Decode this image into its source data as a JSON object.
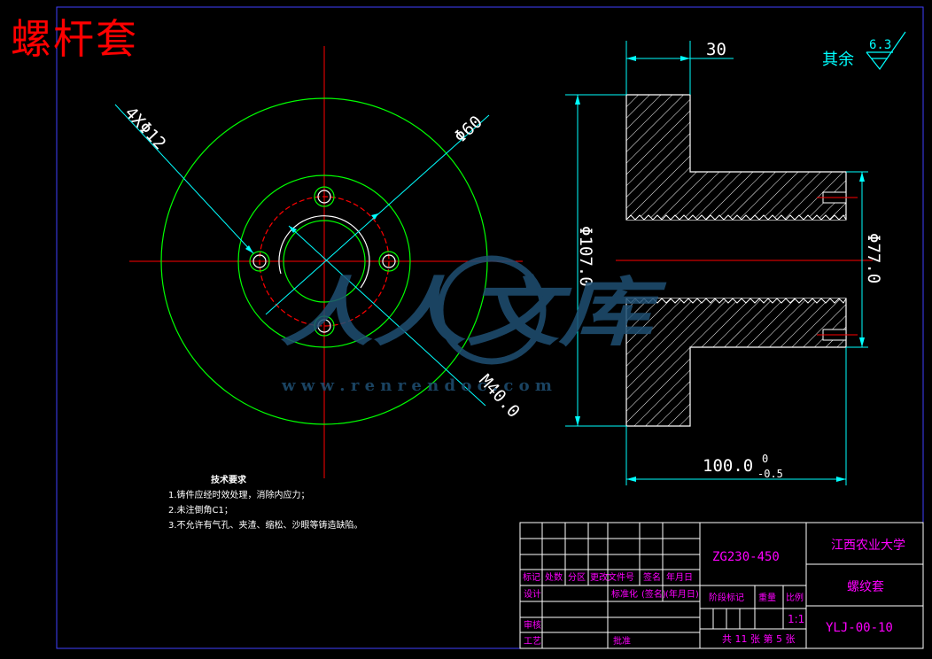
{
  "title": "螺杆套",
  "dimensions": {
    "holes": "4XΦ12",
    "bolt_circle": "Φ60",
    "thread": "M40.0",
    "width_top": "30",
    "outer_dia": "Φ107.0",
    "inner_dia": "Φ77.0",
    "length": "100.0",
    "tol_upper": "0",
    "tol_lower": "-0.5"
  },
  "roughness": {
    "label": "其余",
    "value": "6.3"
  },
  "notes": {
    "heading": "技术要求",
    "items": [
      "1.铸件应经时效处理，消除内应力；",
      "2.未注倒角C1；",
      "3.不允许有气孔、夹渣、缩松、沙眼等铸造缺陷。"
    ]
  },
  "title_block": {
    "material": "ZG230-450",
    "school": "江西农业大学",
    "part_name": "螺纹套",
    "drawing_no": "YLJ-00-10",
    "scale": "1:1",
    "sheets": "共 11 张 第 5 张",
    "labels": {
      "mark": "标记",
      "count": "处数",
      "zone": "分区",
      "change_doc": "更改文件号",
      "sign": "签名",
      "date": "年月日",
      "design": "设计",
      "standardize": "标准化",
      "sign2": "(签名)",
      "date2": "(年月日)",
      "stage": "阶段标记",
      "weight": "重量",
      "ratio": "比例",
      "review": "审核",
      "process": "工艺",
      "approve": "批准"
    }
  },
  "watermark": {
    "text": "人人文库",
    "url": "w w w . r e n r e n d o c . c o m"
  },
  "colors": {
    "background": "#000000",
    "white": "#ffffff",
    "green": "#00ff00",
    "red": "#ff0000",
    "cyan": "#00ffff",
    "magenta": "#ff00ff",
    "blue": "#4040ff",
    "watermark": "#1f4f73"
  }
}
